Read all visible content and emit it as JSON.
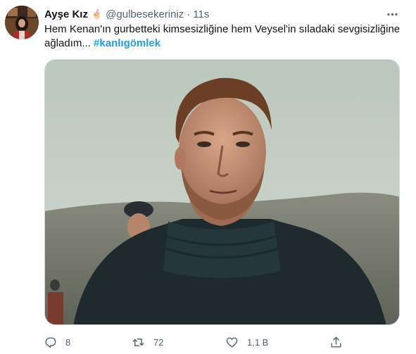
{
  "tweet": {
    "author": {
      "display_name": "Ayşe Kız",
      "emoji": "🤞🏻",
      "handle": "@gulbesekeriniz",
      "separator": "·",
      "time": "11s"
    },
    "text_main": "Hem Kenan'ın gurbetteki kimsesizliğine hem Veysel'in sıladaki sevgisizliğine ağladım... ",
    "hashtag": "#kanlıgömlek",
    "actions": {
      "reply_count": "8",
      "retweet_count": "72",
      "like_count": "1,1 B"
    }
  },
  "icons": {
    "more": "more-horizontal-icon",
    "reply": "reply-icon",
    "retweet": "retweet-icon",
    "like": "heart-icon",
    "share": "share-icon"
  },
  "colors": {
    "link": "#1d9bf0",
    "secondary_text": "#536471",
    "primary_text": "#0f1419"
  }
}
